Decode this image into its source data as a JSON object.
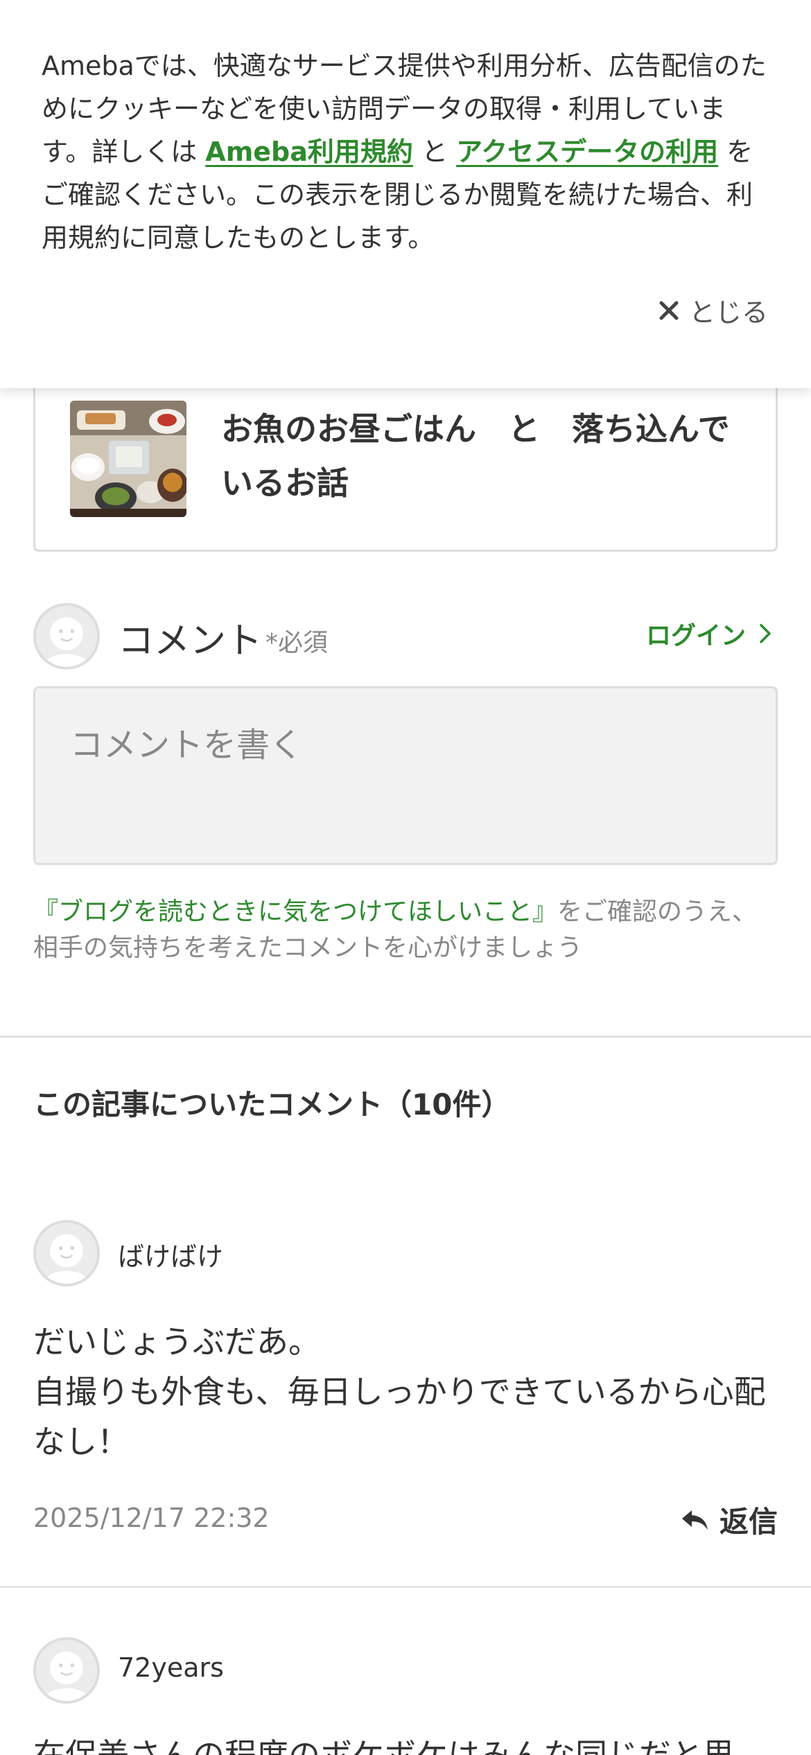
{
  "cookie_banner": {
    "text_1": "Amebaでは、快適なサービス提供や利用分析、広告配信のためにクッキーなどを使い訪問データの取得・利用しています。詳しくは ",
    "link_terms": "Ameba利用規約",
    "text_2": " と ",
    "link_access_data": "アクセスデータの利用",
    "text_3": " をご確認ください。この表示を閉じるか閲覧を続けた場合、利用規約に同意したものとします。",
    "close_label": "とじる"
  },
  "article": {
    "title": "お魚のお昼ごはん　と　落ち込んでいるお話"
  },
  "comment_form": {
    "label": "コメント",
    "required": "*必須",
    "login_label": "ログイン",
    "placeholder": "コメントを書く",
    "guideline_link": "『ブログを読むときに気をつけてほしいこと』",
    "guideline_text": "をご確認のうえ、相手の気持ちを考えたコメントを心がけましょう"
  },
  "comments_section": {
    "heading": "この記事についたコメント（10件）"
  },
  "comments": [
    {
      "name": "ばけばけ",
      "body": "だいじょうぶだあ。\n自撮りも外食も、毎日しっかりできているから心配なし！",
      "date": "2025/12/17 22:32",
      "reply_label": "返信"
    },
    {
      "name": "72years",
      "body": "在保美さんの程度のボケボケはみんな同じだと思",
      "date": "",
      "reply_label": ""
    }
  ],
  "colors": {
    "accent_green": "#2d8a2d",
    "text": "#333333",
    "muted": "#888888"
  },
  "icons": {
    "close": "close-icon",
    "chevron": "chevron-right-icon",
    "reply": "reply-icon",
    "avatar": "default-avatar-icon"
  }
}
